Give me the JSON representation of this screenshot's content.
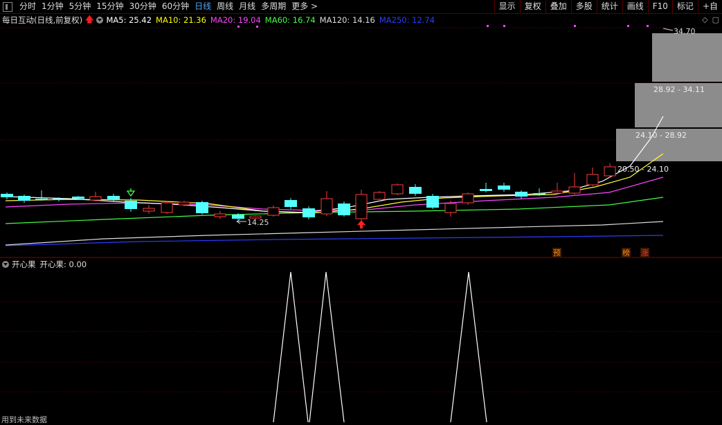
{
  "toolbar": {
    "tabs": [
      {
        "label": "分时"
      },
      {
        "label": "1分钟"
      },
      {
        "label": "5分钟"
      },
      {
        "label": "15分钟"
      },
      {
        "label": "30分钟"
      },
      {
        "label": "60分钟"
      },
      {
        "label": "日线"
      },
      {
        "label": "周线"
      },
      {
        "label": "月线"
      },
      {
        "label": "多周期"
      },
      {
        "label": "更多 >"
      }
    ],
    "active_tab": "日线",
    "right_buttons": [
      {
        "label": "显示"
      },
      {
        "label": "复权"
      },
      {
        "label": "叠加"
      },
      {
        "label": "多股"
      },
      {
        "label": "统计"
      },
      {
        "label": "画线"
      },
      {
        "label": "F10"
      },
      {
        "label": "标记"
      },
      {
        "label": "+自"
      }
    ]
  },
  "info": {
    "title": "每日互动(日线,前复权)",
    "ma": [
      {
        "label": "MA5: 25.42",
        "color": "#ffffff"
      },
      {
        "label": "MA10: 21.36",
        "color": "#ffff00"
      },
      {
        "label": "MA20: 19.04",
        "color": "#ff44ff"
      },
      {
        "label": "MA60: 16.74",
        "color": "#44ff44"
      },
      {
        "label": "MA120: 14.16",
        "color": "#dddddd"
      },
      {
        "label": "MA250: 12.74",
        "color": "#2a3cff"
      }
    ]
  },
  "price_labels": {
    "high": "34.70",
    "low": "14.25"
  },
  "volume_profile": [
    {
      "label": "28.92 - 34.11"
    },
    {
      "label": "24.10 - 28.92"
    },
    {
      "label": "20.50 - 24.10"
    }
  ],
  "markers": [
    {
      "label": "预",
      "color": "#ff8c1a"
    },
    {
      "label": "榜",
      "color": "#ff8c1a"
    },
    {
      "label": "涨",
      "color": "#ff3333"
    }
  ],
  "sub_indicator": {
    "name": "开心果",
    "value_label": "开心果: 0.00"
  },
  "footer_note": "用到未来数据",
  "colors": {
    "up": "#ff3b3b",
    "down": "#54ffff",
    "grid": "#7a0000"
  }
}
